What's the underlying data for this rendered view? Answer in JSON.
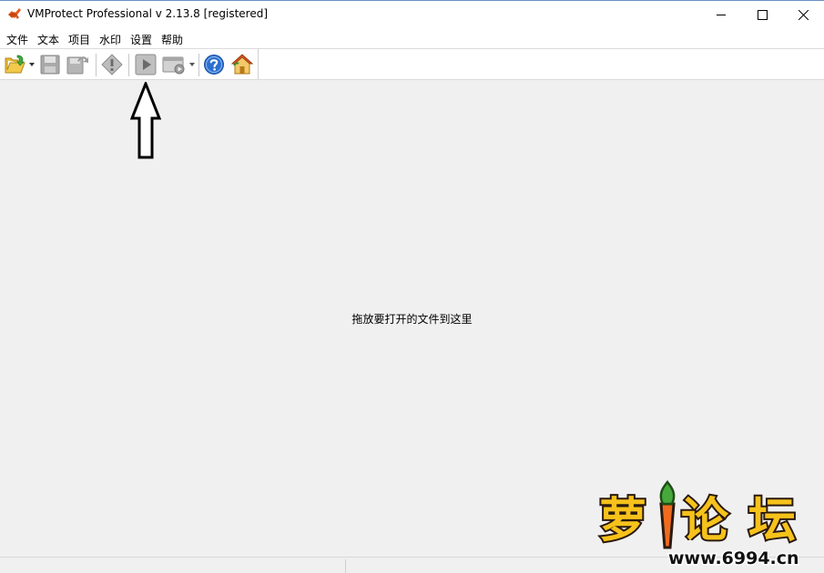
{
  "window": {
    "title": "VMProtect Professional v 2.13.8 [registered]",
    "app_icon": "vmprotect-logo-icon",
    "controls": [
      "minimize-icon",
      "maximize-icon",
      "close-icon"
    ]
  },
  "menu": {
    "items": [
      {
        "label": "文件"
      },
      {
        "label": "文本"
      },
      {
        "label": "项目"
      },
      {
        "label": "水印"
      },
      {
        "label": "设置"
      },
      {
        "label": "帮助"
      }
    ]
  },
  "toolbar": {
    "buttons": [
      {
        "icon": "open-folder-icon",
        "has_dropdown": true,
        "enabled": true
      },
      {
        "icon": "save-icon",
        "enabled": false
      },
      {
        "icon": "save-as-icon",
        "enabled": false
      },
      {
        "icon": "properties-icon",
        "enabled": false
      },
      {
        "icon": "compile-run-icon",
        "enabled": false
      },
      {
        "icon": "execute-icon",
        "has_dropdown": true,
        "enabled": false
      },
      {
        "icon": "help-icon",
        "enabled": true
      },
      {
        "icon": "home-icon",
        "enabled": true
      }
    ]
  },
  "annotation": {
    "icon": "up-arrow-annotation-icon"
  },
  "main": {
    "drop_hint": "拖放要打开的文件到这里"
  },
  "watermark": {
    "text": "萝卜论坛",
    "url": "www.6994.cn"
  },
  "colors": {
    "background": "#f0f0f0",
    "titlebar": "#ffffff",
    "logo_orange": "#e85a1c",
    "help_blue": "#2c6fcf",
    "watermark_yellow": "#f6c21b"
  }
}
